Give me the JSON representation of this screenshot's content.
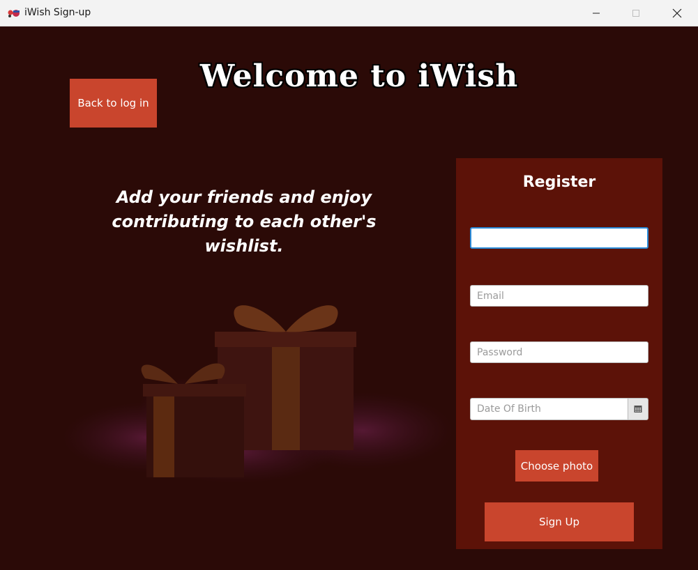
{
  "window": {
    "title": "iWish Sign-up",
    "app_icon": "iwish-logo-icon",
    "controls": [
      "minimize-icon",
      "maximize-icon",
      "close-icon"
    ]
  },
  "header": {
    "welcome": "Welcome to iWish",
    "back_button": "Back to log in"
  },
  "hero": {
    "tagline_line1": "Add your friends and enjoy",
    "tagline_line2": "contributing to each other's wishlist."
  },
  "register": {
    "title": "Register",
    "name_value": "",
    "email_placeholder": "Email",
    "password_placeholder": "Password",
    "dob_placeholder": "Date Of Birth",
    "calendar_icon": "calendar-icon",
    "choose_photo": "Choose photo",
    "sign_up": "Sign Up"
  },
  "colors": {
    "background": "#2b0a07",
    "panel": "#5c1208",
    "accent": "#c9452d",
    "focus": "#2a8bd8"
  }
}
